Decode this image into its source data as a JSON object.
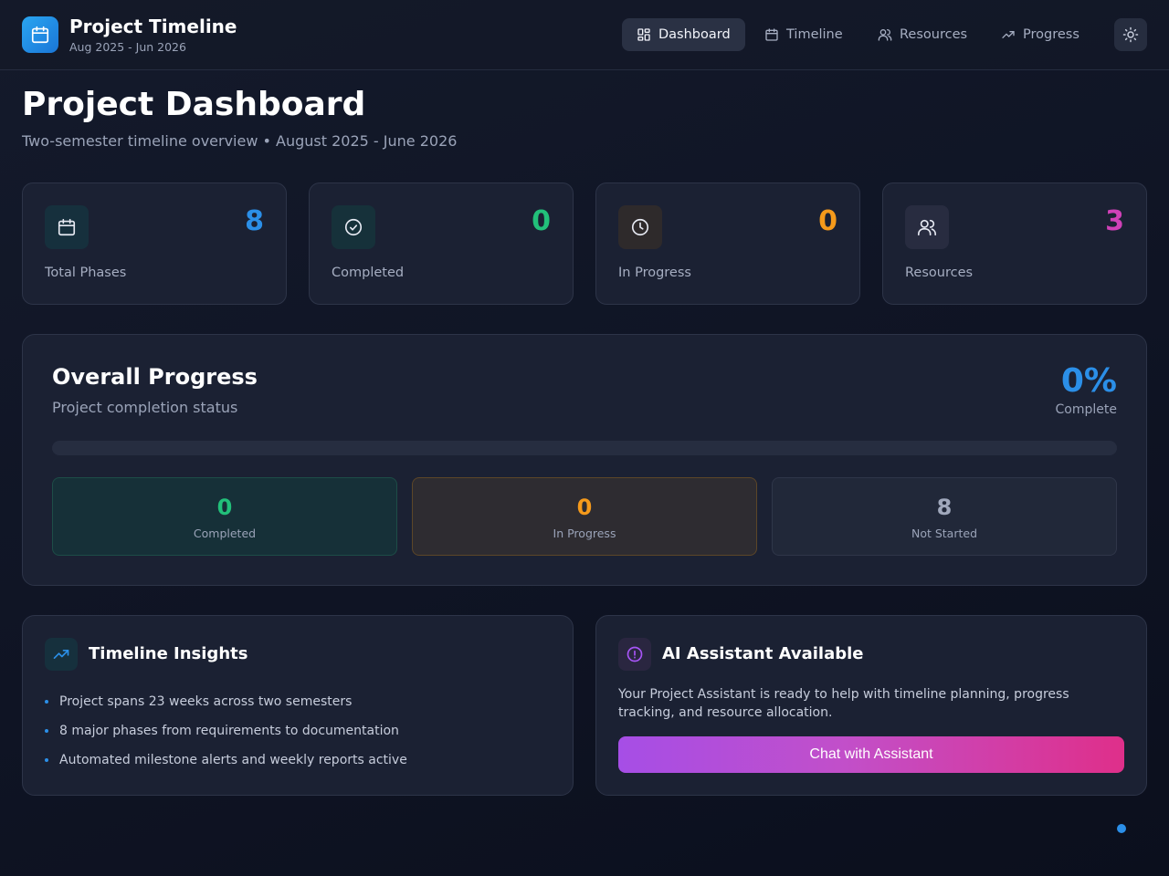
{
  "colors": {
    "blue": "#2b8fe8",
    "green": "#22c07a",
    "orange": "#f59a1b",
    "magenta": "#d041b8",
    "purple": "#a855f7",
    "gray": "#a0a8bc"
  },
  "header": {
    "title": "Project Timeline",
    "subtitle": "Aug 2025 - Jun 2026",
    "nav": [
      {
        "label": "Dashboard",
        "icon": "dashboard-icon",
        "active": true
      },
      {
        "label": "Timeline",
        "icon": "calendar-icon",
        "active": false
      },
      {
        "label": "Resources",
        "icon": "users-icon",
        "active": false
      },
      {
        "label": "Progress",
        "icon": "trending-up-icon",
        "active": false
      }
    ],
    "theme_toggle_icon": "sun-icon"
  },
  "page": {
    "title": "Project Dashboard",
    "subtitle": "Two-semester timeline overview • August 2025 - June 2026"
  },
  "stats": [
    {
      "label": "Total Phases",
      "value": "8",
      "icon": "calendar-icon",
      "color": "#2b8fe8"
    },
    {
      "label": "Completed",
      "value": "0",
      "icon": "check-circle-icon",
      "color": "#22c07a"
    },
    {
      "label": "In Progress",
      "value": "0",
      "icon": "clock-icon",
      "color": "#f59a1b"
    },
    {
      "label": "Resources",
      "value": "3",
      "icon": "users-icon",
      "color": "#d041b8"
    }
  ],
  "overall": {
    "title": "Overall Progress",
    "subtitle": "Project completion status",
    "percent_text": "0%",
    "percent_label": "Complete",
    "progress_fraction": 0,
    "breakdown": [
      {
        "value": "0",
        "label": "Completed"
      },
      {
        "value": "0",
        "label": "In Progress"
      },
      {
        "value": "8",
        "label": "Not Started"
      }
    ]
  },
  "insights": {
    "title": "Timeline Insights",
    "icon": "trending-up-icon",
    "items": [
      "Project spans 23 weeks across two semesters",
      "8 major phases from requirements to documentation",
      "Automated milestone alerts and weekly reports active"
    ]
  },
  "assistant": {
    "title": "AI Assistant Available",
    "icon": "alert-circle-icon",
    "text": "Your Project Assistant is ready to help with timeline planning, progress tracking, and resource allocation.",
    "button_label": "Chat with Assistant"
  }
}
